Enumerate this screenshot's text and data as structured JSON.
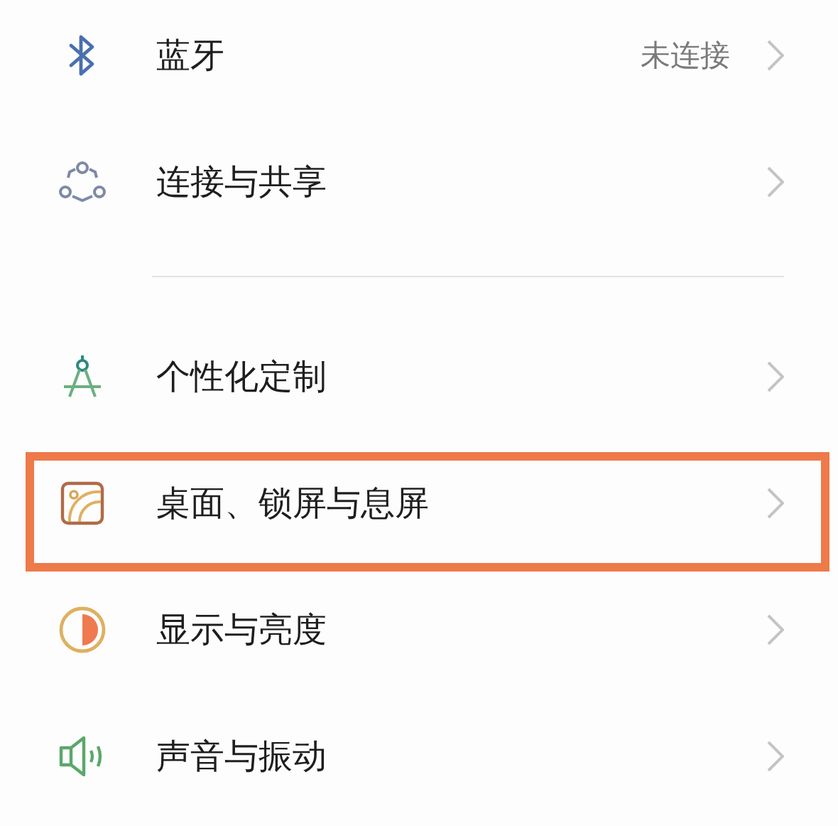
{
  "groups": [
    {
      "items": [
        {
          "kind": "bluetooth",
          "label": "蓝牙",
          "value": "未连接",
          "highlighted": false
        },
        {
          "kind": "share",
          "label": "连接与共享",
          "highlighted": false
        }
      ]
    },
    {
      "items": [
        {
          "kind": "personalize",
          "label": "个性化定制",
          "highlighted": false
        },
        {
          "kind": "wallpaper",
          "label": "桌面、锁屏与息屏",
          "highlighted": true
        },
        {
          "kind": "display",
          "label": "显示与亮度",
          "highlighted": false
        },
        {
          "kind": "sound",
          "label": "声音与振动",
          "highlighted": false
        }
      ]
    }
  ]
}
